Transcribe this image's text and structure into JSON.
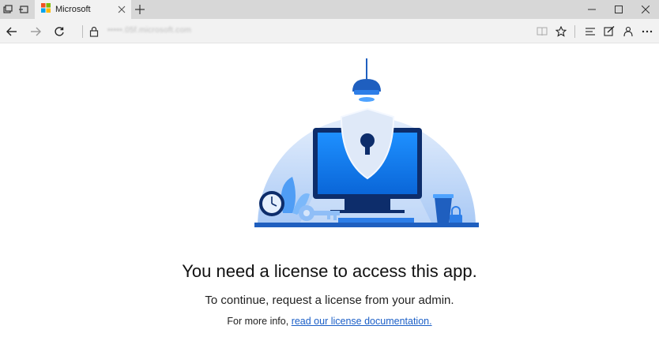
{
  "browser": {
    "tab_title": "Microsoft",
    "url": "•••••.05f.microsoft.com",
    "icons": {
      "tab_actions": "tab-actions-icon",
      "tab_preview": "tab-preview-icon",
      "favicon": "microsoft-logo-icon",
      "tab_close": "close-icon",
      "new_tab": "plus-icon",
      "minimize": "minimize-icon",
      "maximize": "maximize-icon",
      "close": "close-icon",
      "back": "back-arrow-icon",
      "forward": "forward-arrow-icon",
      "refresh": "refresh-icon",
      "lock": "lock-icon",
      "reading_view": "book-icon",
      "favorite": "star-icon",
      "hub": "hub-icon",
      "web_note": "pen-icon",
      "share": "share-icon",
      "more": "ellipsis-icon"
    }
  },
  "content": {
    "headline": "You need a license to access this app.",
    "subline": "To continue, request a license from your admin.",
    "info_prefix": "For more info, ",
    "info_link": "read our license documentation."
  },
  "colors": {
    "accent": "#0078d7",
    "link": "#1b5fc7",
    "tabbar": "#d7d7d7",
    "navbar": "#f2f2f2"
  }
}
